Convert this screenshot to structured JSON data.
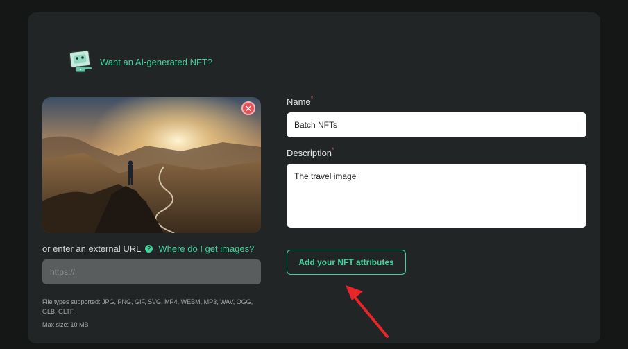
{
  "ai_prompt": {
    "label": "Want an AI-generated NFT?",
    "icon": "robot-icon"
  },
  "image": {
    "remove_icon": "close-icon",
    "remove_symbol": "✕"
  },
  "url": {
    "label": "or enter an external URL",
    "help_icon_symbol": "?",
    "help_link": "Where do I get images?",
    "placeholder": "https://",
    "value": ""
  },
  "file_info": {
    "types": "File types supported: JPG, PNG, GIF, SVG, MP4, WEBM, MP3, WAV, OGG, GLB, GLTF.",
    "max_size": "Max size: 10 MB"
  },
  "form": {
    "name_label": "Name",
    "name_value": "Batch NFTs",
    "description_label": "Description",
    "description_value": "The travel image",
    "required_mark": "*",
    "attributes_button": "Add your NFT attributes"
  },
  "colors": {
    "accent": "#3fd49c",
    "danger": "#e0545a",
    "card": "#212526",
    "page": "#151616"
  }
}
